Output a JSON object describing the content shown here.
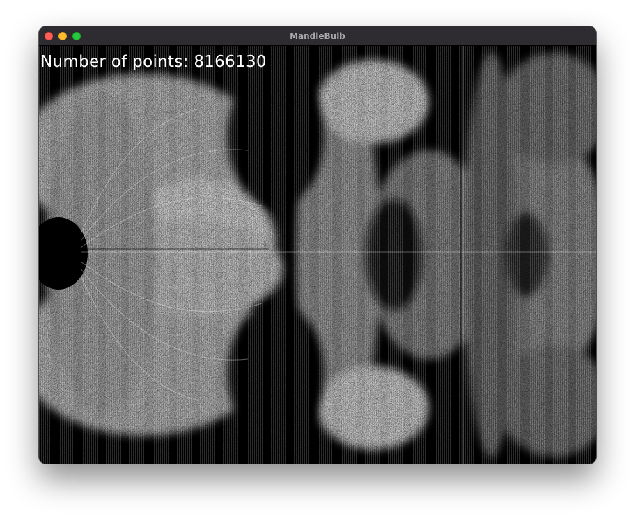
{
  "window": {
    "title": "MandleBulb",
    "controls": {
      "close_color": "#ff5f57",
      "minimize_color": "#febc2e",
      "zoom_color": "#28c840"
    }
  },
  "render": {
    "points_label": "Number of points:",
    "points_value": "8166130",
    "background_color": "#000000",
    "point_color": "#ffffff"
  }
}
